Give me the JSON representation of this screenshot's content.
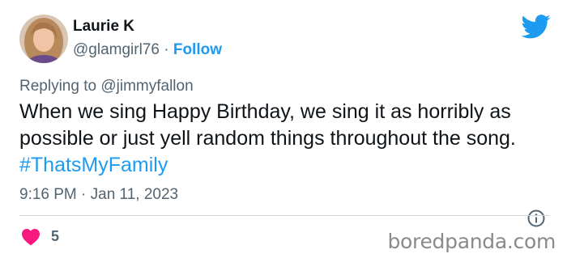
{
  "user": {
    "name": "Laurie K",
    "handle": "@glamgirl76",
    "separator": " · ",
    "follow_label": "Follow"
  },
  "reply": {
    "text": "Replying to @jimmyfallon"
  },
  "tweet": {
    "text": "When we sing Happy Birthday, we sing it as horribly as possible or just yell random things throughout the song. ",
    "hashtag": "#ThatsMyFamily",
    "timestamp": "9:16 PM · Jan 11, 2023"
  },
  "engagement": {
    "likes": "5"
  },
  "watermark": "boredpanda.com",
  "colors": {
    "accent": "#1d9bf0",
    "heart": "#f91880",
    "secondary_text": "#536471"
  },
  "icons": {
    "brand": "twitter-bird-icon",
    "info": "info-icon",
    "like": "heart-icon"
  }
}
